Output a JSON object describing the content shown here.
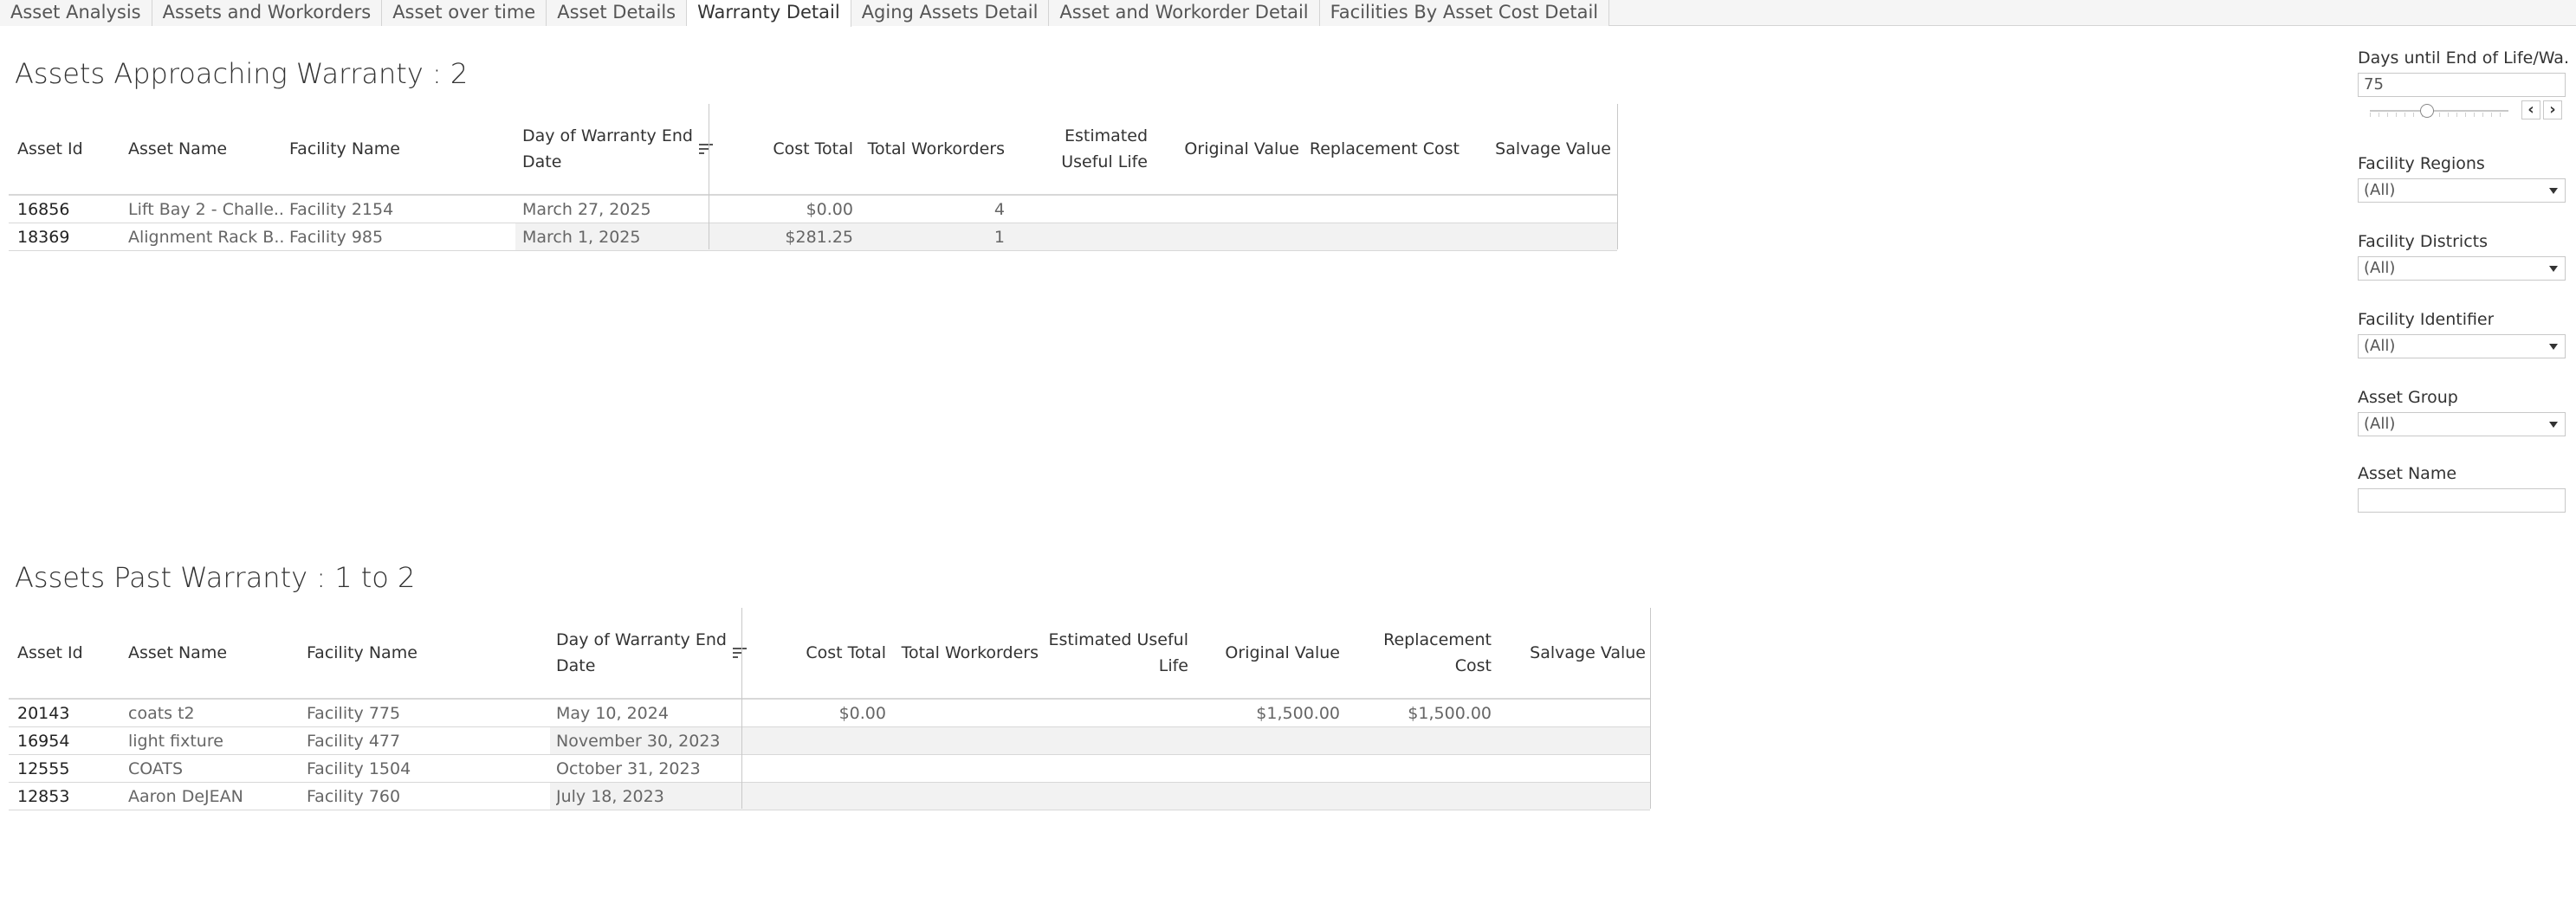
{
  "tabs": [
    {
      "label": "Asset Analysis",
      "active": false
    },
    {
      "label": "Assets and Workorders",
      "active": false
    },
    {
      "label": "Asset over time",
      "active": false
    },
    {
      "label": "Asset Details",
      "active": false
    },
    {
      "label": "Warranty Detail",
      "active": true
    },
    {
      "label": "Aging Assets Detail",
      "active": false
    },
    {
      "label": "Asset and Workorder Detail",
      "active": false
    },
    {
      "label": "Facilities By Asset Cost Detail",
      "active": false
    }
  ],
  "approaching": {
    "title": "Assets Approaching Warranty : 2",
    "headers": {
      "asset_id": "Asset Id",
      "asset_name": "Asset Name",
      "facility_name": "Facility Name",
      "warranty_end": "Day of Warranty End Date",
      "cost_total": "Cost Total",
      "total_workorders": "Total Workorders",
      "useful_life": "Estimated Useful Life",
      "original_value": "Original Value",
      "replacement_cost": "Replacement Cost",
      "salvage_value": "Salvage Value"
    },
    "rows": [
      {
        "asset_id": "16856",
        "asset_name": "Lift Bay 2 - Challe..",
        "facility_name": "Facility 2154",
        "warranty_end": "March 27, 2025",
        "cost_total": "$0.00",
        "total_workorders": "4",
        "useful_life": "",
        "original_value": "",
        "replacement_cost": "",
        "salvage_value": ""
      },
      {
        "asset_id": "18369",
        "asset_name": "Alignment Rack B..",
        "facility_name": "Facility 985",
        "warranty_end": "March 1, 2025",
        "cost_total": "$281.25",
        "total_workorders": "1",
        "useful_life": "",
        "original_value": "",
        "replacement_cost": "",
        "salvage_value": ""
      }
    ]
  },
  "past": {
    "title": "Assets Past Warranty : 1 to 2",
    "headers": {
      "asset_id": "Asset Id",
      "asset_name": "Asset Name",
      "facility_name": "Facility Name",
      "warranty_end": "Day of Warranty End Date",
      "cost_total": "Cost Total",
      "total_workorders": "Total Workorders",
      "useful_life": "Estimated Useful Life",
      "original_value": "Original Value",
      "replacement_cost": "Replacement Cost",
      "salvage_value": "Salvage Value"
    },
    "rows": [
      {
        "asset_id": "20143",
        "asset_name": "coats t2",
        "facility_name": "Facility 775",
        "warranty_end": "May 10, 2024",
        "cost_total": "$0.00",
        "total_workorders": "",
        "useful_life": "",
        "original_value": "$1,500.00",
        "replacement_cost": "$1,500.00",
        "salvage_value": ""
      },
      {
        "asset_id": "16954",
        "asset_name": "light fixture",
        "facility_name": "Facility 477",
        "warranty_end": "November 30, 2023",
        "cost_total": "",
        "total_workorders": "",
        "useful_life": "",
        "original_value": "",
        "replacement_cost": "",
        "salvage_value": ""
      },
      {
        "asset_id": "12555",
        "asset_name": "COATS",
        "facility_name": "Facility 1504",
        "warranty_end": "October 31, 2023",
        "cost_total": "",
        "total_workorders": "",
        "useful_life": "",
        "original_value": "",
        "replacement_cost": "",
        "salvage_value": ""
      },
      {
        "asset_id": "12853",
        "asset_name": "Aaron DeJEAN",
        "facility_name": "Facility 760",
        "warranty_end": "July 18, 2023",
        "cost_total": "",
        "total_workorders": "",
        "useful_life": "",
        "original_value": "",
        "replacement_cost": "",
        "salvage_value": ""
      }
    ]
  },
  "filters": {
    "days_label": "Days until End of Life/Wa...",
    "days_value": "75",
    "regions_label": "Facility Regions",
    "regions_value": "(All)",
    "districts_label": "Facility Districts",
    "districts_value": "(All)",
    "identifier_label": "Facility Identifier",
    "identifier_value": "(All)",
    "group_label": "Asset Group",
    "group_value": "(All)",
    "asset_name_label": "Asset Name",
    "asset_name_value": ""
  }
}
